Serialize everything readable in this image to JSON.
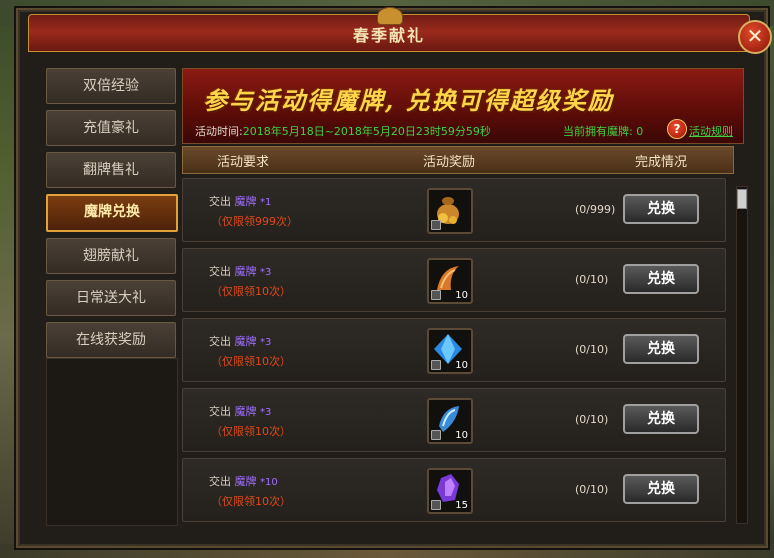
{
  "window": {
    "title": "春季献礼",
    "close_label": "✕"
  },
  "sidebar": {
    "items": [
      {
        "label": "双倍经验",
        "active": false
      },
      {
        "label": "充值豪礼",
        "active": false
      },
      {
        "label": "翻牌售礼",
        "active": false
      },
      {
        "label": "魔牌兑换",
        "active": true
      },
      {
        "label": "翅膀献礼",
        "active": false
      },
      {
        "label": "日常送大礼",
        "active": false
      },
      {
        "label": "在线获奖励",
        "active": false
      }
    ]
  },
  "banner": {
    "title": "参与活动得魔牌, 兑换可得超级奖励",
    "time_label": "活动时间:",
    "time_value": "2018年5月18日~2018年5月20日23时59分59秒",
    "count_label": "当前拥有魔牌: 0",
    "rules_link": "活动规则"
  },
  "table": {
    "headers": [
      "活动要求",
      "活动奖励",
      "完成情况"
    ],
    "rows": [
      {
        "give": "交出",
        "item": "魔牌",
        "mult": "*1",
        "limit": "（仅限领999次）",
        "reward": "money-bag-icon",
        "qty": "",
        "progress": "(0/999)",
        "button": "兑换"
      },
      {
        "give": "交出",
        "item": "魔牌",
        "mult": "*3",
        "limit": "（仅限领10次）",
        "reward": "horn-icon",
        "qty": "10",
        "progress": "(0/10)",
        "button": "兑换"
      },
      {
        "give": "交出",
        "item": "魔牌",
        "mult": "*3",
        "limit": "（仅限领10次）",
        "reward": "blue-gem-icon",
        "qty": "10",
        "progress": "(0/10)",
        "button": "兑换"
      },
      {
        "give": "交出",
        "item": "魔牌",
        "mult": "*3",
        "limit": "（仅限领10次）",
        "reward": "blue-crystal-icon",
        "qty": "10",
        "progress": "(0/10)",
        "button": "兑换"
      },
      {
        "give": "交出",
        "item": "魔牌",
        "mult": "*10",
        "limit": "（仅限领10次）",
        "reward": "purple-crystal-icon",
        "qty": "15",
        "progress": "(0/10)",
        "button": "兑换"
      }
    ]
  },
  "colors": {
    "accent": "#e1a03a",
    "green_text": "#40d040",
    "purple_item": "#a070ff",
    "red_limit": "#e04a1a"
  }
}
